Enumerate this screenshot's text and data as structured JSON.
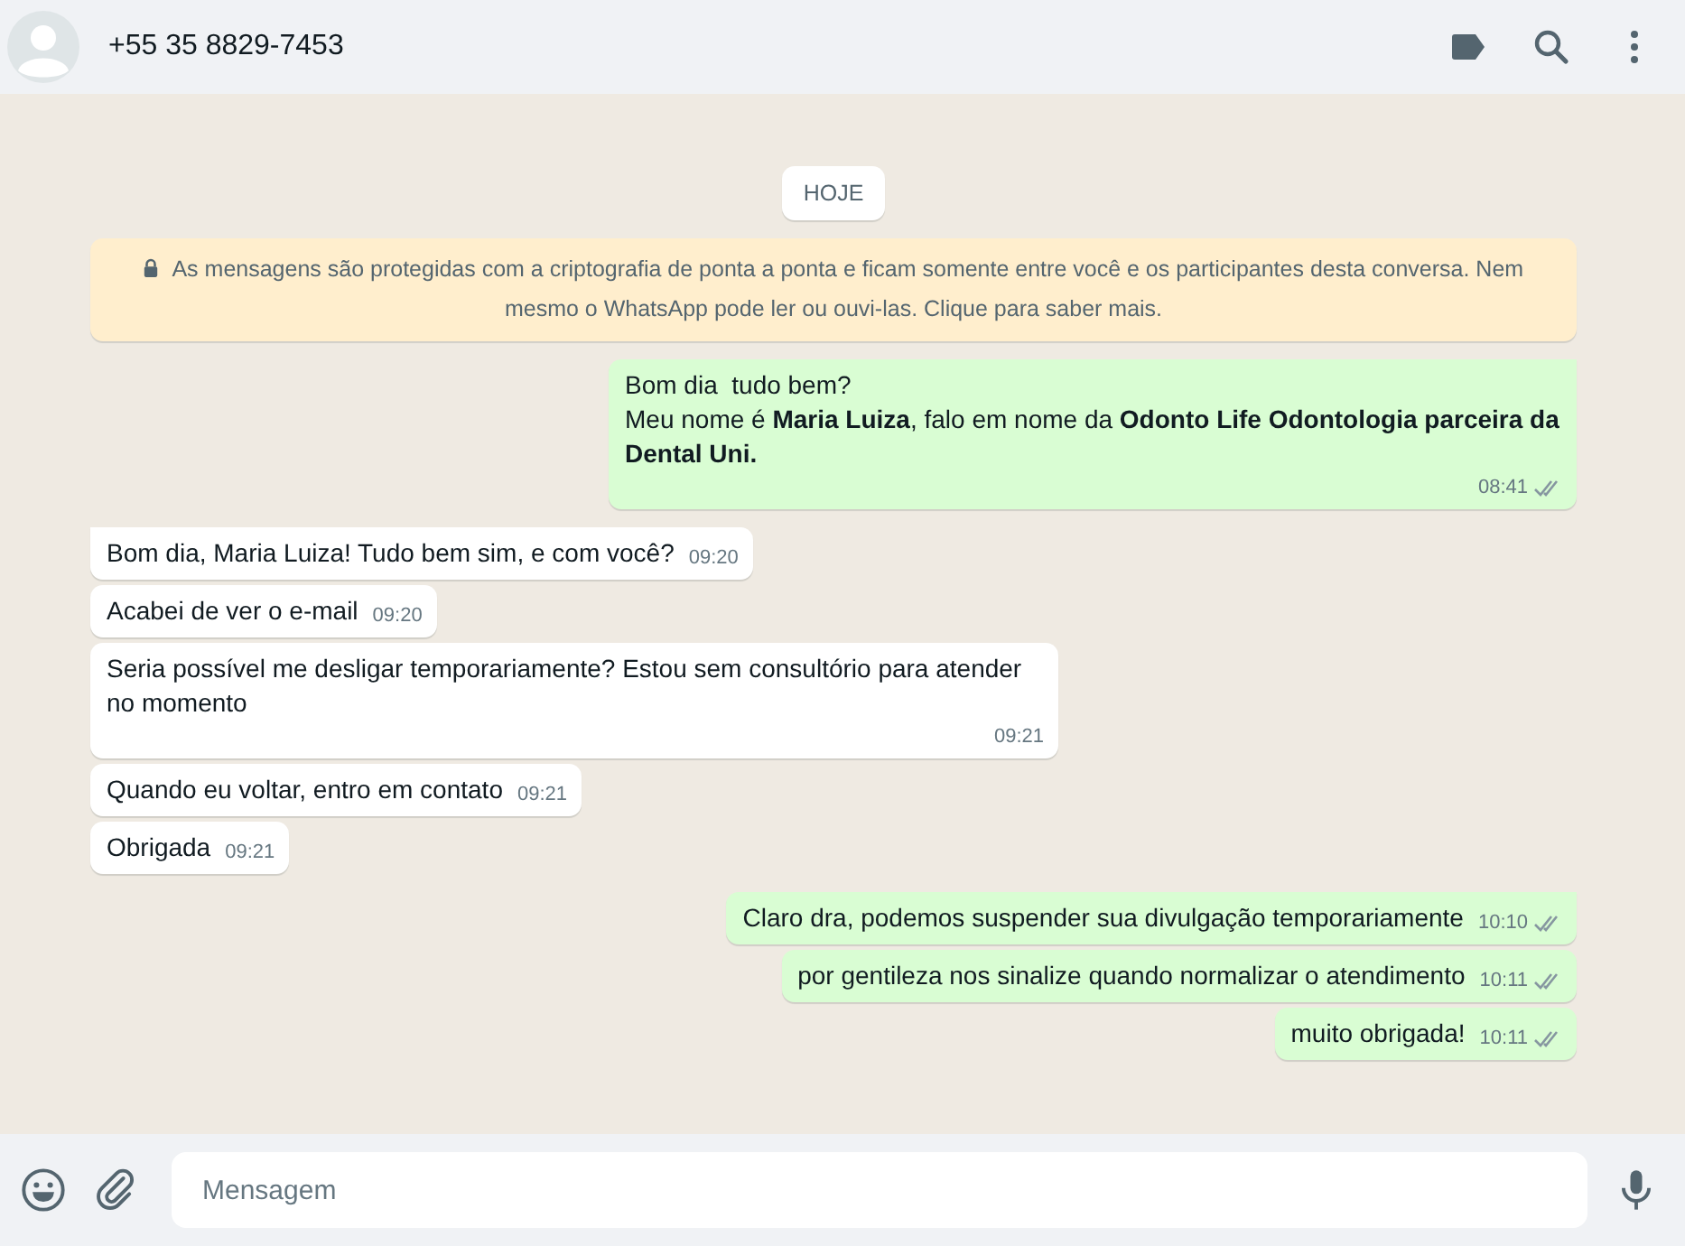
{
  "header": {
    "contact": "+55 35 8829-7453"
  },
  "date_chip": "HOJE",
  "encryption_notice": "As mensagens são protegidas com a criptografia de ponta a ponta e ficam somente entre você e os participantes desta conversa. Nem mesmo o WhatsApp pode ler ou ouvi-las. Clique para saber mais.",
  "messages": [
    {
      "kind": "out",
      "text": "Bom dia  tudo bem?\nMeu nome é **Maria Luiza**, falo em nome da **Odonto Life Odontologia parceira da Dental Uni.**",
      "time": "08:41",
      "read": false,
      "first": true
    },
    {
      "kind": "in",
      "text": "Bom dia, Maria Luiza! Tudo bem sim, e com você?",
      "time": "09:20",
      "first": true
    },
    {
      "kind": "in",
      "text": "Acabei de ver o e-mail",
      "time": "09:20",
      "first": false
    },
    {
      "kind": "in",
      "text": "Seria possível me desligar temporariamente? Estou sem consultório para atender no momento",
      "time": "09:21",
      "first": false
    },
    {
      "kind": "in",
      "text": "Quando eu voltar, entro em contato",
      "time": "09:21",
      "first": false
    },
    {
      "kind": "in",
      "text": "Obrigada",
      "time": "09:21",
      "first": false
    },
    {
      "kind": "out",
      "text": "Claro dra, podemos suspender sua divulgação temporariamente",
      "time": "10:10",
      "read": false,
      "first": true
    },
    {
      "kind": "out",
      "text": "por gentileza nos sinalize quando normalizar o atendimento",
      "time": "10:11",
      "read": false,
      "first": false
    },
    {
      "kind": "out",
      "text": "muito obrigada!",
      "time": "10:11",
      "read": false,
      "first": false
    }
  ],
  "composer": {
    "placeholder": "Mensagem"
  }
}
